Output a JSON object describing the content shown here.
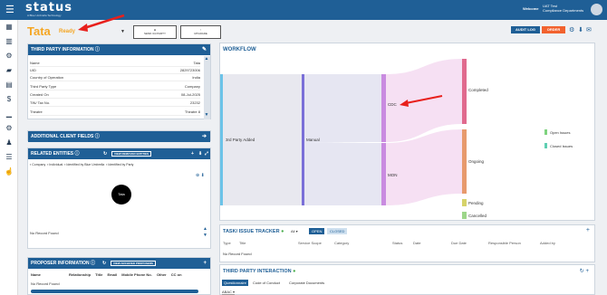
{
  "header": {
    "logo": "status",
    "logo_sub": "A Blue Umbrella Technology",
    "welcome": "Welcome",
    "user_name": "UAT Test",
    "user_dept": "Compliance Departments"
  },
  "page": {
    "title": "Tata",
    "status": "Ready",
    "btn_send": "SEND 3rd PARTY",
    "btn_upgrade": "UPGRADE",
    "audit_log": "AUDIT LOG",
    "order": "ORDER"
  },
  "third_party": {
    "heading": "THIRD PARTY INFORMATION",
    "rows": [
      {
        "k": "Name",
        "v": "Tata"
      },
      {
        "k": "UID",
        "v": "2829723006"
      },
      {
        "k": "Country of Operation",
        "v": "India"
      },
      {
        "k": "Third Party Type",
        "v": "Company"
      },
      {
        "k": "Created On",
        "v": "08-Jul-2025"
      },
      {
        "k": "TIN/ Tax No.",
        "v": "23232"
      },
      {
        "k": "Theatre",
        "v": "Theatre 8"
      }
    ]
  },
  "additional": {
    "heading": "ADDITIONAL CLIENT FIELDS"
  },
  "related": {
    "heading": "RELATED ENTITIES",
    "btn": "VIEW REMOVED ENTITIES",
    "legend": [
      "Company",
      "Individual",
      "Identified by Blue Umbrella",
      "Identified by Party"
    ],
    "node": "Tata",
    "empty": "No Record Found"
  },
  "proposer": {
    "heading": "PROPOSER INFORMATION",
    "btn": "VIEW ARCHIVED PROPOSERS",
    "cols": [
      "Name",
      "Relationship",
      "Title",
      "Email",
      "Mobile Phone No.",
      "Other",
      "CC on"
    ],
    "empty": "No Record Found"
  },
  "workflow": {
    "heading": "WORKFLOW",
    "nodes": {
      "tp": "3rd Party Added",
      "manual": "Manual",
      "cdc": "CDC",
      "mon": "MON",
      "completed": "Completed",
      "ongoing": "Ongoing",
      "pending": "Pending",
      "cancelled": "Cancelled"
    },
    "legend": [
      {
        "label": "Open Issues",
        "color": "#7ed37e"
      },
      {
        "label": "Closed Issues",
        "color": "#5fcfb2"
      }
    ]
  },
  "task": {
    "heading": "TASK/ ISSUE TRACKER",
    "filter": "All",
    "open": "OPEN",
    "closed": "CLOSED",
    "cols": [
      "Type",
      "Title",
      "Service Scope",
      "Category",
      "Status",
      "Date",
      "Due Date",
      "Responsible Person",
      "Added by"
    ],
    "empty": "No Record Found"
  },
  "interaction": {
    "heading": "THIRD PARTY INTERACTION",
    "tabs": [
      "Questionnaire",
      "Code of Conduct",
      "Corporate Documents"
    ],
    "sub": "ABAC"
  },
  "colors": {
    "brand": "#1f5f96",
    "accent": "#f5a623",
    "order": "#f2622e",
    "arrow": "#e8201c"
  }
}
